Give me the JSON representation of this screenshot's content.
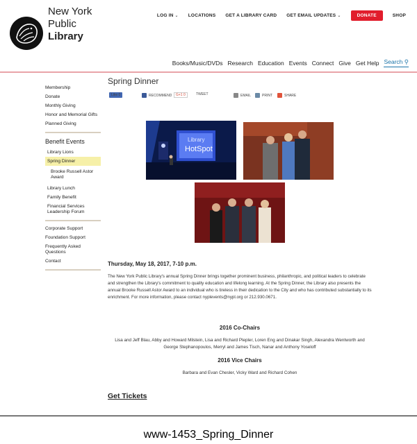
{
  "logo": {
    "line1": "New York",
    "line2": "Public",
    "line3": "Library"
  },
  "utility_nav": {
    "login": "LOG IN",
    "locations": "LOCATIONS",
    "library_card": "GET A LIBRARY CARD",
    "email_updates": "GET EMAIL UPDATES",
    "donate": "DONATE",
    "shop": "SHOP",
    "donate_color": "#e11d2c"
  },
  "main_nav": {
    "items": [
      "Books/Music/DVDs",
      "Research",
      "Education",
      "Events",
      "Connect",
      "Give",
      "Get Help"
    ],
    "search": "Search"
  },
  "sidebar": {
    "group1": [
      "Membership",
      "Donate",
      "Monthly Giving",
      "Honor and Memorial Gifts",
      "Planned Giving"
    ],
    "heading": "Benefit Events",
    "group2": {
      "library_lions": "Library Lions",
      "spring_dinner": "Spring Dinner",
      "astor_award": "Brooke Russell Astor Award",
      "library_lunch": "Library Lunch",
      "family_benefit": "Family Benefit",
      "financial_services": "Financial Services Leadership Forum"
    },
    "group3": [
      "Corporate Support",
      "Foundation Support",
      "Frequently Asked Questions",
      "Contact"
    ]
  },
  "page": {
    "title": "Spring Dinner",
    "share": {
      "like": "Like 0",
      "recommend": "RECOMMEND",
      "plusone": "G+1 0",
      "tweet": "TWEET",
      "email": "EMAIL",
      "print": "PRINT",
      "share": "SHARE"
    },
    "photo1_sign": "HotSpot",
    "event_date": "Thursday, May 18, 2017, 7-10 p.m.",
    "description": "The New York Public Library's annual Spring Dinner brings together prominent business, philanthropic, and political leaders to celebrate and strengthen the Library's commitment to quality education and lifelong learning.  At the Spring Dinner, the Library also presents the annual Brooke Russell Astor Award to an individual who is tireless in their dedication to the City and who has contributed substantially to its enrichment. For more information, please contact nyplevents@nypl.org or 212.930.0671.",
    "cochairs_heading": "2016 Co-Chairs",
    "cochairs_text": "Lisa and Jeff Blau, Abby and Howard Milstein, Lisa and Richard Plepler, Loren Eng and Dinakar Singh, Alexandra Wentworth and George Stephanopoulos, Merryl and James Tisch, Nanar and Anthony Yoseloff",
    "vicechairs_heading": "2016 Vice Chairs",
    "vicechairs_text": "Barbara and Evan Chesler, Vicky Ward and Richard Cohen",
    "get_tickets": "Get Tickets"
  },
  "caption": "www-1453_Spring_Dinner"
}
